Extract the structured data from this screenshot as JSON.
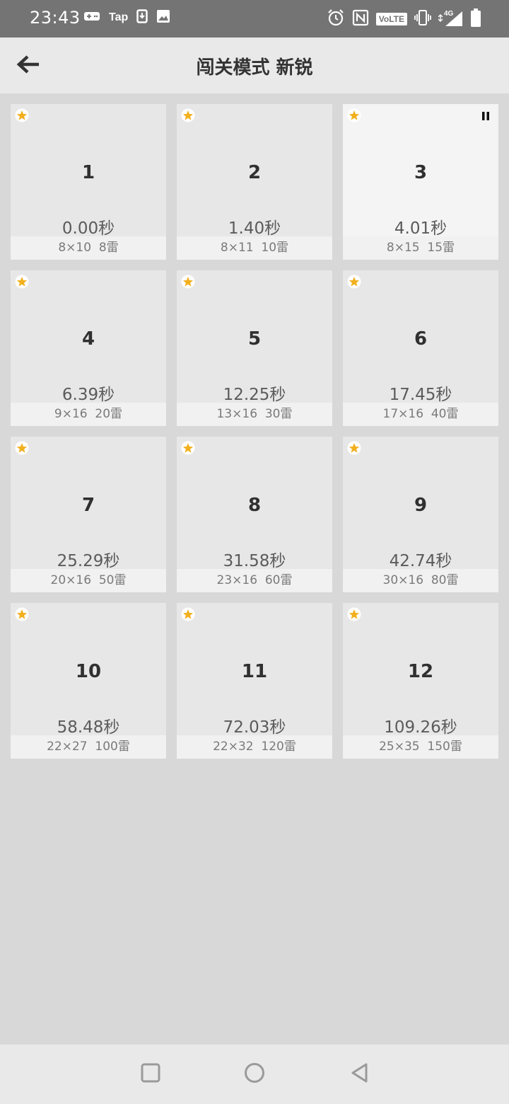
{
  "status_bar": {
    "time": "23:43",
    "left_icons": [
      "gamepad-icon",
      "tap-icon",
      "download-icon",
      "image-icon"
    ],
    "tap_label": "Tap",
    "right_icons": [
      "alarm-icon",
      "nfc-icon",
      "volte-icon",
      "vibrate-icon",
      "signal-4g-icon",
      "battery-icon"
    ],
    "volte_label": "VoLTE",
    "network_label": "4G"
  },
  "app_bar": {
    "back_icon": "arrow-left-icon",
    "title": "闯关模式 新锐"
  },
  "colors": {
    "star": "#f2b01e",
    "page_bg": "#d8d8d8",
    "card_bg": "#e7e7e7",
    "current_card_bg": "#f4f4f4",
    "status_bar_bg": "#747474"
  },
  "levels": [
    {
      "number": "1",
      "time": "0.00秒",
      "footer": "8×10  8雷",
      "starred": true,
      "current": false
    },
    {
      "number": "2",
      "time": "1.40秒",
      "footer": "8×11  10雷",
      "starred": true,
      "current": false
    },
    {
      "number": "3",
      "time": "4.01秒",
      "footer": "8×15  15雷",
      "starred": true,
      "current": true
    },
    {
      "number": "4",
      "time": "6.39秒",
      "footer": "9×16  20雷",
      "starred": true,
      "current": false
    },
    {
      "number": "5",
      "time": "12.25秒",
      "footer": "13×16  30雷",
      "starred": true,
      "current": false
    },
    {
      "number": "6",
      "time": "17.45秒",
      "footer": "17×16  40雷",
      "starred": true,
      "current": false
    },
    {
      "number": "7",
      "time": "25.29秒",
      "footer": "20×16  50雷",
      "starred": true,
      "current": false
    },
    {
      "number": "8",
      "time": "31.58秒",
      "footer": "23×16  60雷",
      "starred": true,
      "current": false
    },
    {
      "number": "9",
      "time": "42.74秒",
      "footer": "30×16  80雷",
      "starred": true,
      "current": false
    },
    {
      "number": "10",
      "time": "58.48秒",
      "footer": "22×27  100雷",
      "starred": true,
      "current": false
    },
    {
      "number": "11",
      "time": "72.03秒",
      "footer": "22×32  120雷",
      "starred": true,
      "current": false
    },
    {
      "number": "12",
      "time": "109.26秒",
      "footer": "25×35  150雷",
      "starred": true,
      "current": false
    }
  ],
  "nav_bar": {
    "buttons": [
      "recents-square-icon",
      "home-circle-icon",
      "back-triangle-icon"
    ]
  }
}
